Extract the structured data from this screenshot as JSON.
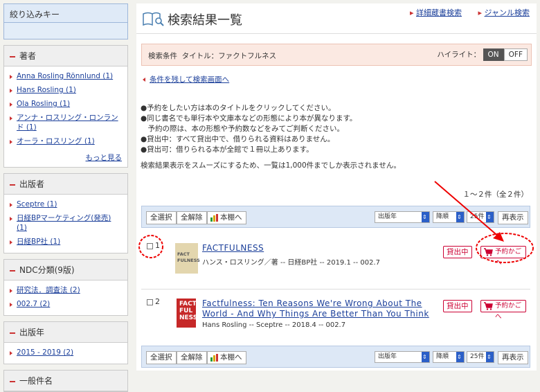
{
  "sidebar": {
    "title": "絞り込みキー",
    "author": {
      "heading": "著者",
      "items": [
        "Anna Rosling Rönnlund (1)",
        "Hans Rosling (1)",
        "Ola Rosling (1)",
        "アンナ・ロスリング・ロンランド (1)",
        "オーラ・ロスリング (1)"
      ],
      "more": "もっと見る"
    },
    "publisher": {
      "heading": "出版者",
      "items": [
        "Sceptre (1)",
        "日経BPマーケティング(発売) (1)",
        "日経BP社 (1)"
      ]
    },
    "ndc": {
      "heading": "NDC分類(9版)",
      "items": [
        "研究法．調査法 (2)",
        "002.7 (2)"
      ]
    },
    "year": {
      "heading": "出版年",
      "items": [
        "2015 - 2019 (2)"
      ]
    },
    "subject": {
      "heading": "一般件名"
    }
  },
  "main": {
    "title": "検索結果一覧",
    "links": [
      "詳細蔵書検索",
      "ジャンル検索"
    ],
    "condition": "検索条件  タイトル：ファクトフルネス",
    "highlight": "ハイライト：",
    "on": "ON",
    "off": "OFF",
    "back": "条件を残して検索画面へ",
    "notes": [
      "●予約をしたい方は本のタイトルをクリックしてください。",
      "●同じ書名でも単行本や文庫本などの形態により本が異なります。",
      "　予約の際は、本の形態や予約数などをみてご判断ください。",
      "●貸出中：すべて貸出中で、借りられる資料はありません。",
      "●貸出可：借りられる本が全館で１冊以上あります。"
    ],
    "notice": "検索結果表示をスムーズにするため、一覧は1,000件までしか表示されません。",
    "hits": "１～２件（全２件）",
    "toolbar": {
      "select_all": "全選択",
      "clear_all": "全解除",
      "shelf": "本棚へ",
      "sort": "出版年",
      "order": "降順",
      "per": "25件",
      "redisplay": "再表示"
    },
    "results": [
      {
        "num": "1",
        "title": "FACTFULNESS",
        "title2": "",
        "meta": "ハンス・ロスリング／著 -- 日経BP社 -- 2019.1 -- 002.7",
        "status": "貸出中",
        "cart": "予約かごへ",
        "cover": "FACT FULNESS"
      },
      {
        "num": "2",
        "title": "Factfulness: Ten Reasons We're Wrong About The",
        "title2": "World - And Why Things Are Better Than You Think",
        "meta": "Hans Rosling -- Sceptre -- 2018.4 -- 002.7",
        "status": "貸出中",
        "cart": "予約かごへ",
        "cover": "FACT FUL NESS"
      }
    ]
  }
}
